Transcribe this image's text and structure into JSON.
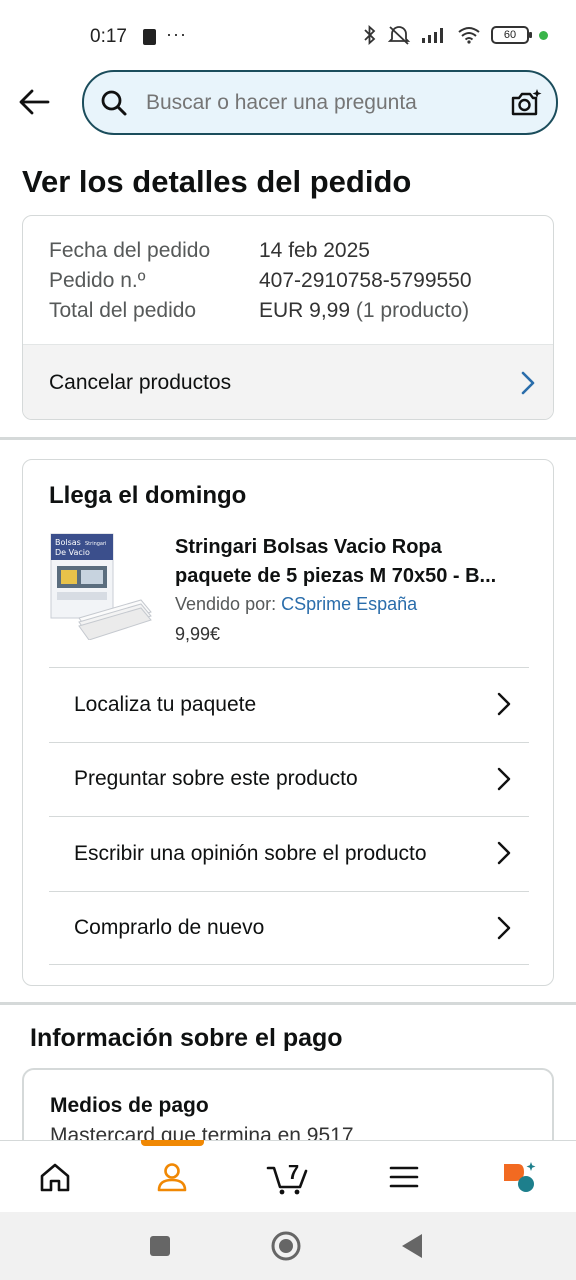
{
  "status_bar": {
    "time": "0:17",
    "dots": "···",
    "battery": "60"
  },
  "search": {
    "placeholder": "Buscar o hacer una pregunta"
  },
  "page_title": "Ver los detalles del pedido",
  "order_summary": {
    "rows": [
      {
        "label": "Fecha del pedido",
        "value": "14 feb 2025"
      },
      {
        "label": "Pedido n.º",
        "value": "407-2910758-5799550"
      },
      {
        "label": "Total del pedido",
        "value": "EUR 9,99",
        "extra": "(1 producto)"
      }
    ],
    "cancel_label": "Cancelar productos"
  },
  "delivery": {
    "title": "Llega el domingo",
    "product": {
      "name_line1": "Stringari Bolsas Vacio Ropa",
      "name_line2": "paquete de 5 piezas M 70x50 - B...",
      "sold_by_label": "Vendido por:",
      "seller": "CSprime España",
      "price": "9,99€",
      "box_text_top": "Bolsas",
      "box_text_mid": "De Vacio",
      "box_brand": "Stringari"
    },
    "actions": [
      {
        "label": "Localiza tu paquete"
      },
      {
        "label": "Preguntar sobre este producto"
      },
      {
        "label": "Escribir una opinión sobre el producto"
      },
      {
        "label": "Comprarlo de nuevo"
      }
    ]
  },
  "payment": {
    "section_title": "Información sobre el pago",
    "method_label": "Medios de pago",
    "method_value": "Mastercard que termina en 9517"
  },
  "bottom_nav": {
    "cart_count": "7",
    "active": "profile",
    "items": [
      "home-icon",
      "profile-icon",
      "cart-icon",
      "menu-icon",
      "assistant-icon"
    ]
  },
  "colors": {
    "accent_orange": "#f08804",
    "link_blue": "#2a6dab",
    "search_border": "#1b4d5c",
    "search_bg": "#e8f4fb"
  }
}
